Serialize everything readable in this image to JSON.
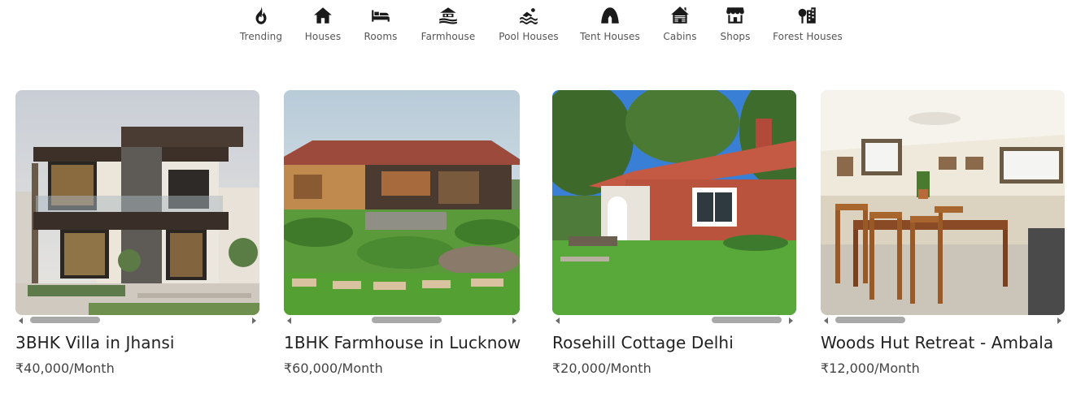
{
  "categories": [
    {
      "label": "Trending",
      "icon": "fire-icon"
    },
    {
      "label": "Houses",
      "icon": "house-icon"
    },
    {
      "label": "Rooms",
      "icon": "bed-icon"
    },
    {
      "label": "Farmhouse",
      "icon": "farmhouse-icon"
    },
    {
      "label": "Pool Houses",
      "icon": "swimmer-icon"
    },
    {
      "label": "Tent Houses",
      "icon": "tent-icon"
    },
    {
      "label": "Cabins",
      "icon": "cabin-icon"
    },
    {
      "label": "Shops",
      "icon": "shop-icon"
    },
    {
      "label": "Forest Houses",
      "icon": "tree-building-icon"
    }
  ],
  "listings": [
    {
      "title": "3BHK Villa in Jhansi",
      "price": "₹40,000/Month"
    },
    {
      "title": "1BHK Farmhouse in Lucknow",
      "price": "₹60,000/Month"
    },
    {
      "title": "Rosehill Cottage Delhi",
      "price": "₹20,000/Month"
    },
    {
      "title": "Woods Hut Retreat - Ambala",
      "price": "₹12,000/Month"
    }
  ],
  "colors": {
    "icon": "#1a1a1a",
    "label": "#555555",
    "title": "#222222",
    "price": "#444444",
    "scroll_thumb": "#a9a9a9"
  }
}
